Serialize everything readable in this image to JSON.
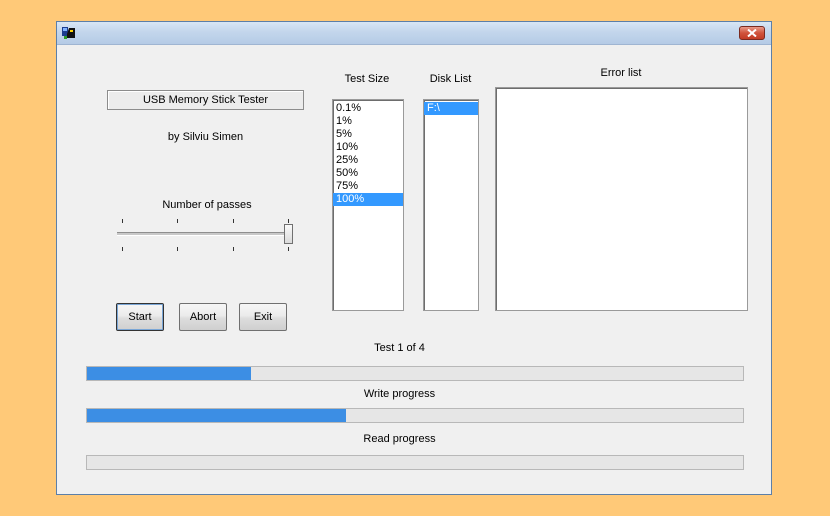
{
  "window": {
    "title": "",
    "icon": "usb-tester-app-icon",
    "close_icon": "close-icon"
  },
  "app": {
    "title": "USB Memory Stick Tester",
    "author": "by Silviu Simen"
  },
  "passes": {
    "label": "Number of passes",
    "value_fraction": 1.0
  },
  "buttons": {
    "start": "Start",
    "abort": "Abort",
    "exit": "Exit"
  },
  "test_size": {
    "label": "Test Size",
    "items": [
      "0.1%",
      "1%",
      "5%",
      "10%",
      "25%",
      "50%",
      "75%",
      "100%"
    ],
    "selected": "100%"
  },
  "disk_list": {
    "label": "Disk List",
    "items": [
      "F:\\"
    ],
    "selected": "F:\\"
  },
  "error_list": {
    "label": "Error list",
    "items": []
  },
  "progress": {
    "test_status": "Test 1 of 4",
    "test_fraction": 0.25,
    "write_label": "Write progress",
    "write_fraction": 0.395,
    "read_label": "Read progress",
    "read_fraction": 0.0
  },
  "colors": {
    "selection": "#3399ff",
    "progress_fill": "#3c8ee4",
    "desktop": "#ffc978"
  }
}
